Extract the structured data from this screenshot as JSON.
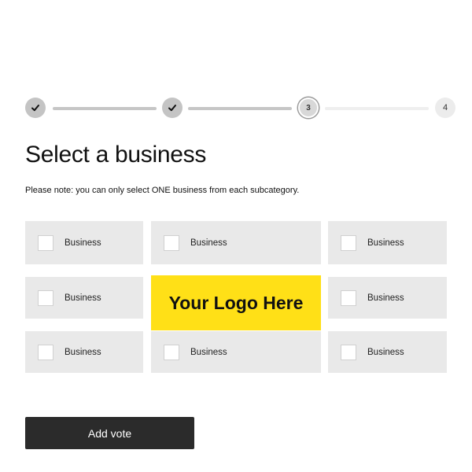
{
  "stepper": {
    "steps": [
      {
        "label": "",
        "state": "done",
        "icon": "check-icon"
      },
      {
        "label": "",
        "state": "done",
        "icon": "check-icon"
      },
      {
        "label": "3",
        "state": "current"
      },
      {
        "label": "4",
        "state": "todo"
      }
    ]
  },
  "page": {
    "title": "Select a business",
    "note": "Please note: you can only select ONE business from each subcategory."
  },
  "grid": {
    "items": [
      {
        "label": "Business"
      },
      {
        "label": "Business"
      },
      {
        "label": "Business"
      },
      {
        "label": "Business"
      },
      {
        "label": "Business"
      },
      {
        "label": "Business"
      },
      {
        "label": "Business"
      },
      {
        "label": "Business"
      }
    ],
    "logo_text": "Your Logo Here"
  },
  "actions": {
    "add_vote_label": "Add vote"
  },
  "colors": {
    "logo_background": "#ffe017",
    "button_background": "#2b2b2b",
    "tile_background": "#e9e9e9"
  }
}
